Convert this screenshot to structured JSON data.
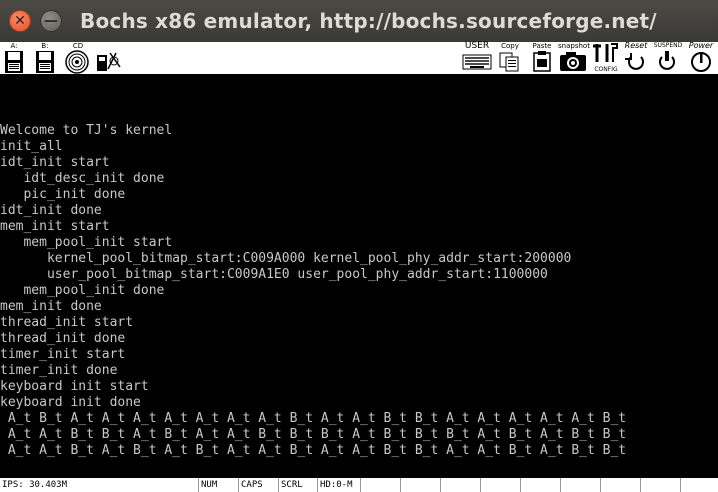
{
  "window": {
    "title": "Bochs x86 emulator, http://bochs.sourceforge.net/",
    "close_glyph": "✕",
    "minimize_glyph": "—"
  },
  "toolbar": {
    "floppy_a_label": "A:",
    "floppy_b_label": "B:",
    "cdrom_label": "CD",
    "user_label": "USER",
    "copy_label": "Copy",
    "paste_label": "Paste",
    "snapshot_label": "snapshot",
    "config_label": "CONFIG",
    "reset_label": "Reset",
    "suspend_label": "SUSPEND",
    "power_label": "Power"
  },
  "console": {
    "lines": [
      "Welcome to TJ's kernel",
      "init_all",
      "idt_init start",
      "   idt_desc_init done",
      "   pic_init done",
      "idt_init done",
      "mem_init start",
      "   mem_pool_init start",
      "      kernel_pool_bitmap_start:C009A000 kernel_pool_phy_addr_start:200000",
      "      user_pool_bitmap_start:C009A1E0 user_pool_phy_addr_start:1100000",
      "   mem_pool_init done",
      "mem_init done",
      "thread_init start",
      "thread_init done",
      "timer_init start",
      "timer_init done",
      "keyboard init start",
      "keyboard init done",
      " A_t B_t A_t A_t A_t A_t A_t A_t A_t B_t A_t A_t B_t B_t A_t A_t A_t A_t A_t B_t",
      " A_t A_t B_t B_t A_t B_t A_t A_t B_t B_t B_t A_t B_t B_t B_t A_t B_t A_t B_t B_t",
      " A_t A_t B_t A_t B_t A_t B_t A_t A_t B_t A_t A_t B_t B_t A_t A_t B_t A_t B_t B_t"
    ]
  },
  "status": {
    "ips": "IPS: 30.403M",
    "num": "NUM",
    "caps": "CAPS",
    "scrl": "SCRL",
    "hd": "HD:0-M"
  }
}
